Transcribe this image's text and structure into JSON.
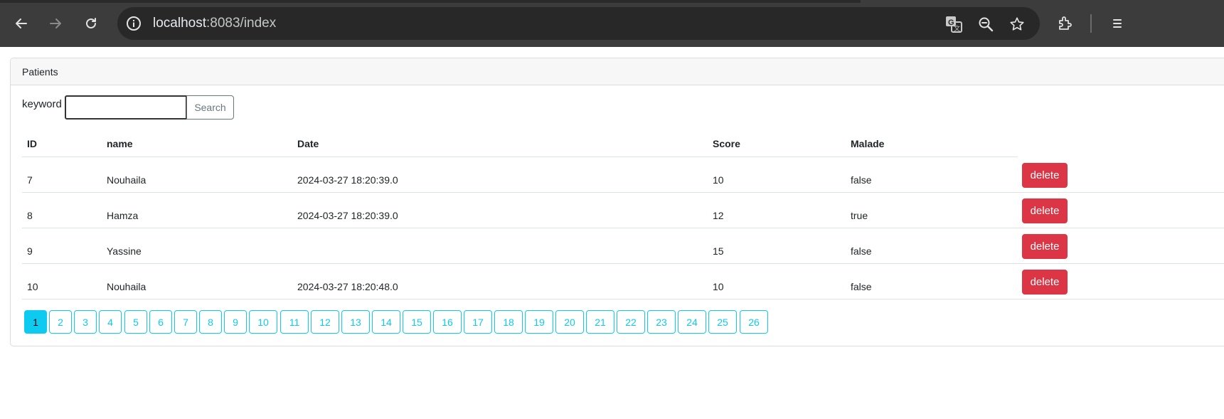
{
  "browser": {
    "url_host": "localhost",
    "url_rest": ":8083/index"
  },
  "card": {
    "title": "Patients",
    "keyword_label": "keyword :",
    "search_value": "",
    "search_button": "Search"
  },
  "table": {
    "headers": [
      "ID",
      "name",
      "Date",
      "Score",
      "Malade"
    ],
    "rows": [
      {
        "id": "7",
        "name": "Nouhaila",
        "date": "2024-03-27 18:20:39.0",
        "score": "10",
        "malade": "false",
        "action": "delete"
      },
      {
        "id": "8",
        "name": "Hamza",
        "date": "2024-03-27 18:20:39.0",
        "score": "12",
        "malade": "true",
        "action": "delete"
      },
      {
        "id": "9",
        "name": "Yassine",
        "date": "",
        "score": "15",
        "malade": "false",
        "action": "delete"
      },
      {
        "id": "10",
        "name": "Nouhaila",
        "date": "2024-03-27 18:20:48.0",
        "score": "10",
        "malade": "false",
        "action": "delete"
      }
    ]
  },
  "pagination": {
    "pages": [
      "1",
      "2",
      "3",
      "4",
      "5",
      "6",
      "7",
      "8",
      "9",
      "10",
      "11",
      "12",
      "13",
      "14",
      "15",
      "16",
      "17",
      "18",
      "19",
      "20",
      "21",
      "22",
      "23",
      "24",
      "25",
      "26"
    ],
    "active": "1"
  },
  "colors": {
    "delete": "#dc3545",
    "page_accent": "#0dcaf0"
  }
}
